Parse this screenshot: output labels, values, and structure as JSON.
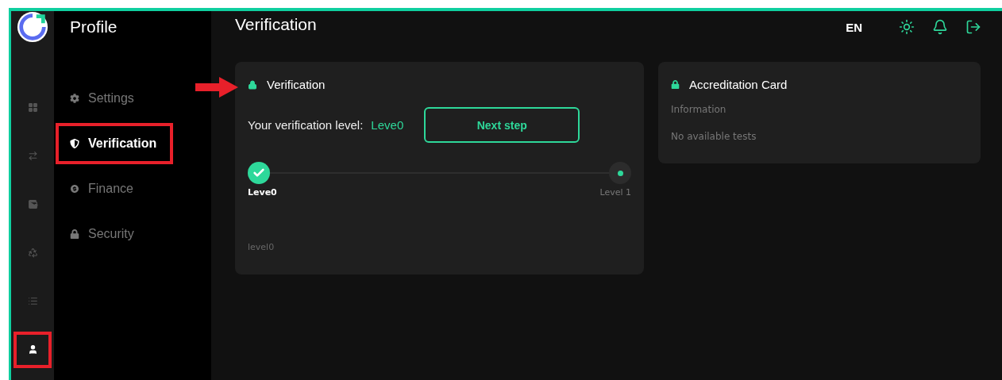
{
  "rail": {
    "items": [
      {
        "selected": false,
        "highlighted": false
      },
      {
        "selected": false,
        "highlighted": false
      },
      {
        "selected": false,
        "highlighted": false
      },
      {
        "selected": false,
        "highlighted": false
      },
      {
        "selected": false,
        "highlighted": false
      },
      {
        "selected": true,
        "highlighted": true
      }
    ]
  },
  "sidebar": {
    "title": "Profile",
    "items": [
      {
        "label": "Settings",
        "selected": false,
        "highlighted": false
      },
      {
        "label": "Verification",
        "selected": true,
        "highlighted": true
      },
      {
        "label": "Finance",
        "selected": false,
        "highlighted": false
      },
      {
        "label": "Security",
        "selected": false,
        "highlighted": false
      }
    ]
  },
  "header": {
    "title": "Verification",
    "language": "EN"
  },
  "verification_card": {
    "title": "Verification",
    "pointed": true,
    "level_label": "Your verification level:",
    "level_value": "Leve0",
    "button": "Next step",
    "steps": [
      {
        "label": "Leve0",
        "done": true
      },
      {
        "label": "Level 1",
        "done": false
      }
    ],
    "footnote": "level0"
  },
  "accreditation_card": {
    "title": "Accreditation Card",
    "subtitle": "Information",
    "message": "No available tests"
  }
}
